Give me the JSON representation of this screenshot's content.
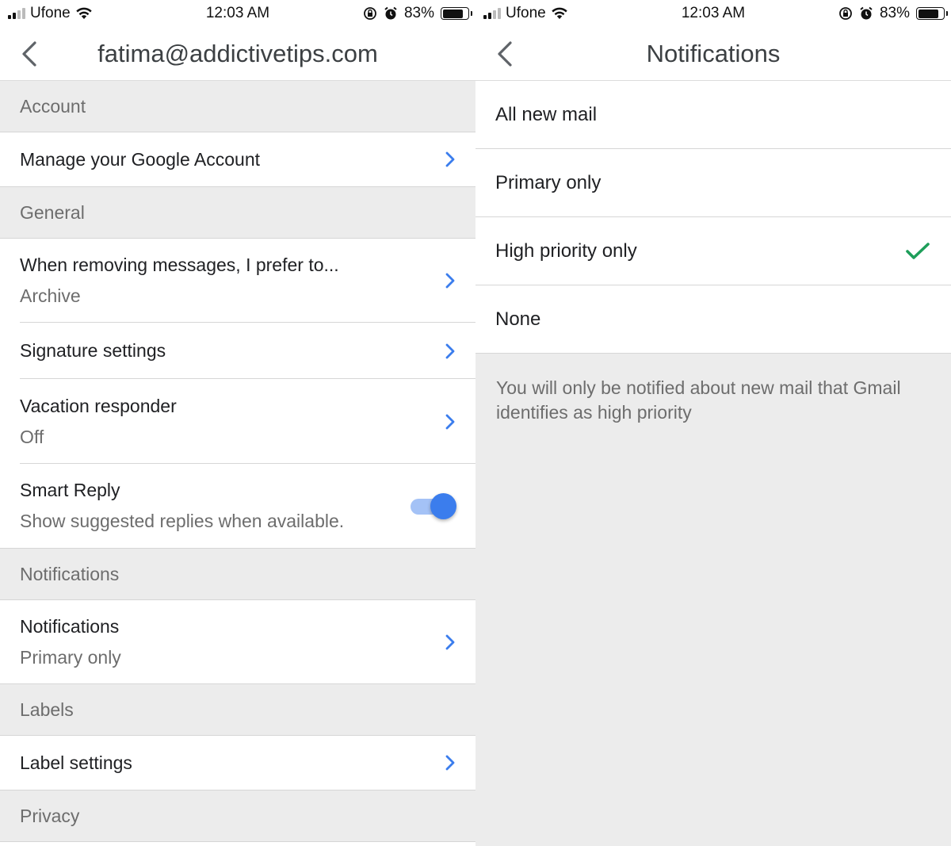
{
  "status_bar": {
    "carrier": "Ufone",
    "time": "12:03 AM",
    "battery_percent": "83%",
    "battery_level": 0.83,
    "icons": [
      "signal-icon",
      "wifi-icon",
      "orientation-lock-icon",
      "alarm-icon",
      "battery-icon"
    ]
  },
  "left": {
    "nav": {
      "title": "fatima@addictivetips.com",
      "back_icon": "chevron-left-icon"
    },
    "sections": [
      {
        "header": "Account",
        "rows": [
          {
            "title": "Manage your Google Account"
          }
        ]
      },
      {
        "header": "General",
        "rows": [
          {
            "title": "When removing messages, I prefer to...",
            "subtitle": "Archive"
          },
          {
            "title": "Signature settings"
          },
          {
            "title": "Vacation responder",
            "subtitle": "Off"
          },
          {
            "title": "Smart Reply",
            "subtitle": "Show suggested replies when available.",
            "toggle": true,
            "toggle_on": true
          }
        ]
      },
      {
        "header": "Notifications",
        "rows": [
          {
            "title": "Notifications",
            "subtitle": "Primary only"
          }
        ]
      },
      {
        "header": "Labels",
        "rows": [
          {
            "title": "Label settings"
          }
        ]
      },
      {
        "header": "Privacy",
        "rows": []
      }
    ]
  },
  "right": {
    "nav": {
      "title": "Notifications",
      "back_icon": "chevron-left-icon"
    },
    "options": [
      {
        "label": "All new mail",
        "selected": false
      },
      {
        "label": "Primary only",
        "selected": false
      },
      {
        "label": "High priority only",
        "selected": true
      },
      {
        "label": "None",
        "selected": false
      }
    ],
    "description": "You will only be notified about new mail that Gmail identifies as high priority"
  },
  "colors": {
    "accent_blue": "#3b7ded",
    "check_green": "#1e9e5a",
    "section_bg": "#ececec",
    "secondary_text": "#6d6d6d"
  }
}
